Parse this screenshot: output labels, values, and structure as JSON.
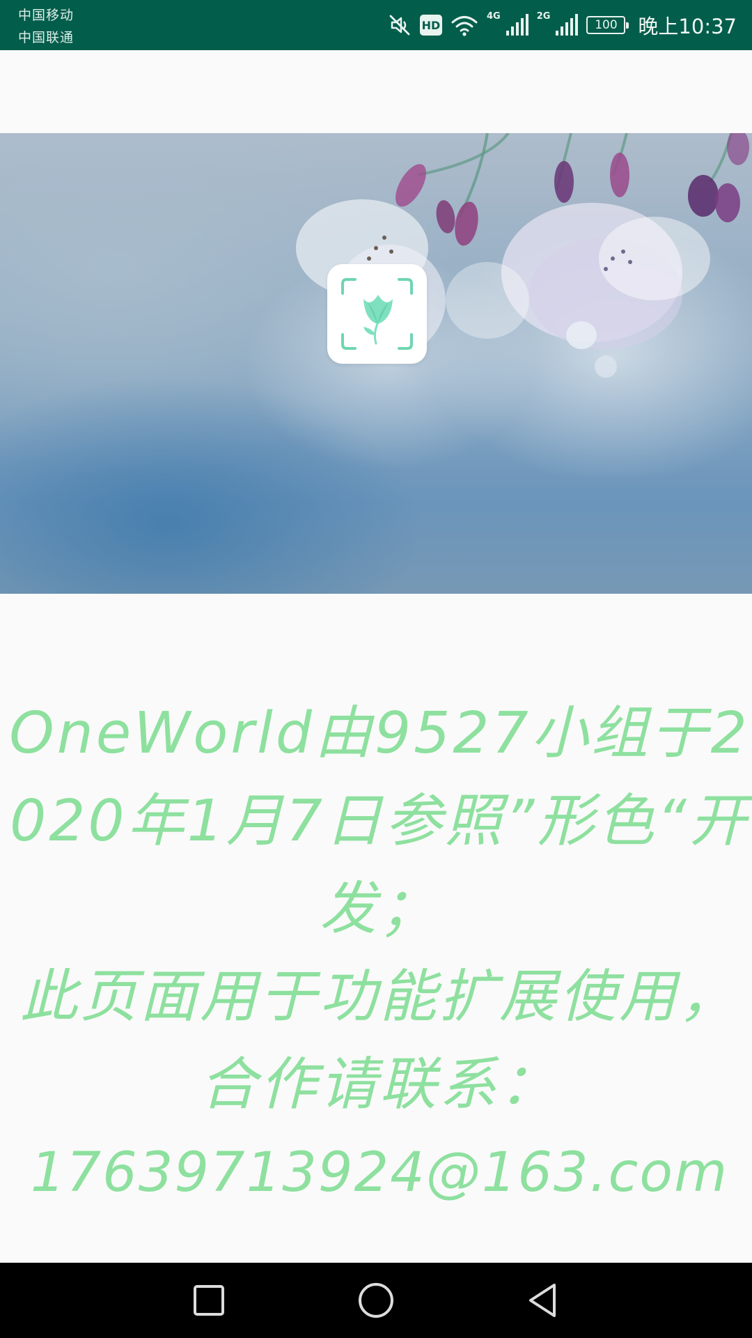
{
  "status_bar": {
    "carrier_1": "中国移动",
    "carrier_2": "中国联通",
    "hd_label": "HD",
    "network_1": "4G",
    "network_2": "2G",
    "battery": "100",
    "time": "晚上10:37",
    "icons": [
      "mute-icon",
      "hd-icon",
      "wifi-icon",
      "signal-4g-icon",
      "signal-2g-icon",
      "battery-icon"
    ],
    "background_color": "#035d4b"
  },
  "hero": {
    "app_icon": "flower-scan-icon",
    "icon_color": "#6fd6b0"
  },
  "info": {
    "line_1": "OneWorld由9527小组于2020年1月7日参照”形色“开发；",
    "line_2": "此页面用于功能扩展使用，合作请联系：",
    "email": "17639713924@163.com",
    "text_color": "#8ee09f"
  },
  "nav_bar": {
    "buttons": [
      "recents-button",
      "home-button",
      "back-button"
    ]
  }
}
